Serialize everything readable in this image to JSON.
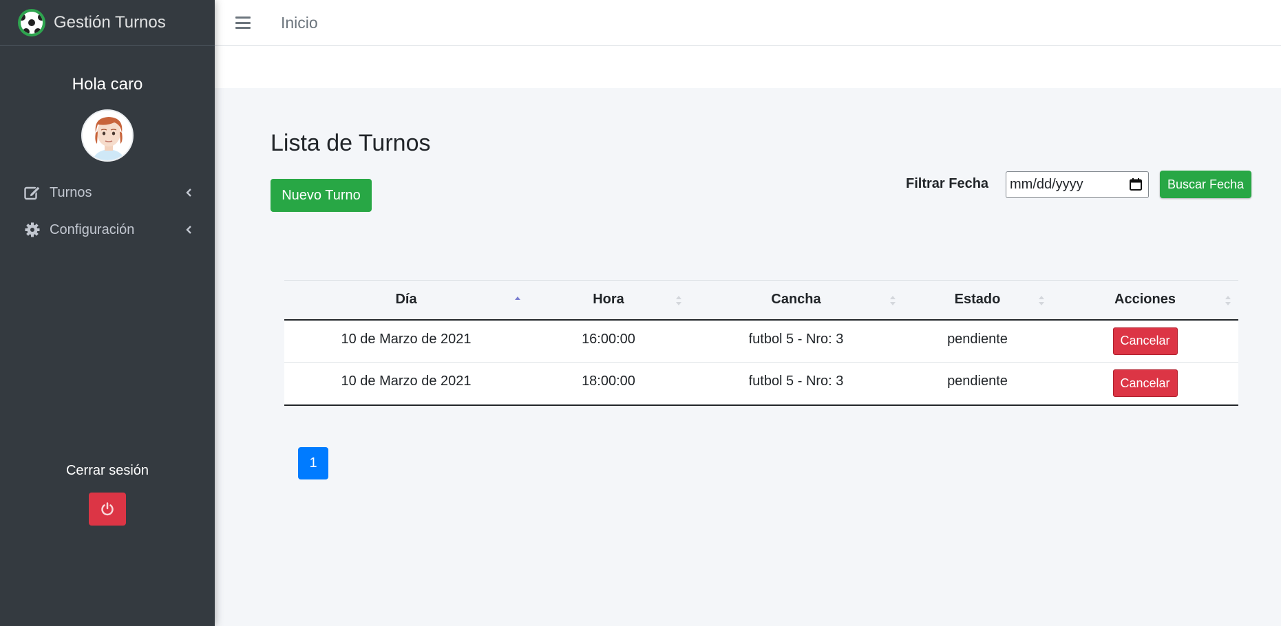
{
  "brand": {
    "title": "Gestión Turnos",
    "logo_icon": "soccer-ball-icon"
  },
  "sidebar": {
    "greeting": "Hola caro",
    "items": [
      {
        "label": "Turnos",
        "icon": "edit-icon"
      },
      {
        "label": "Configuración",
        "icon": "gear-icon"
      }
    ],
    "logout_label": "Cerrar sesión",
    "logout_icon": "power-icon"
  },
  "topbar": {
    "menu_icon": "hamburger-icon",
    "home_link": "Inicio"
  },
  "page": {
    "title": "Lista de Turnos",
    "new_button": "Nuevo Turno",
    "filter_label": "Filtrar Fecha",
    "date_placeholder": "mm/dd/yyyy",
    "search_button": "Buscar Fecha"
  },
  "table": {
    "columns": [
      "Día",
      "Hora",
      "Cancha",
      "Estado",
      "Acciones"
    ],
    "rows": [
      {
        "dia": "10 de Marzo de 2021",
        "hora": "16:00:00",
        "cancha": "futbol 5 - Nro: 3",
        "estado": "pendiente",
        "accion": "Cancelar"
      },
      {
        "dia": "10 de Marzo de 2021",
        "hora": "18:00:00",
        "cancha": "futbol 5 - Nro: 3",
        "estado": "pendiente",
        "accion": "Cancelar"
      }
    ]
  },
  "pagination": {
    "current": "1"
  },
  "colors": {
    "sidebar_bg": "#343a40",
    "success": "#28a745",
    "danger": "#dc3545",
    "primary": "#007bff",
    "content_bg": "#f4f6f9"
  }
}
